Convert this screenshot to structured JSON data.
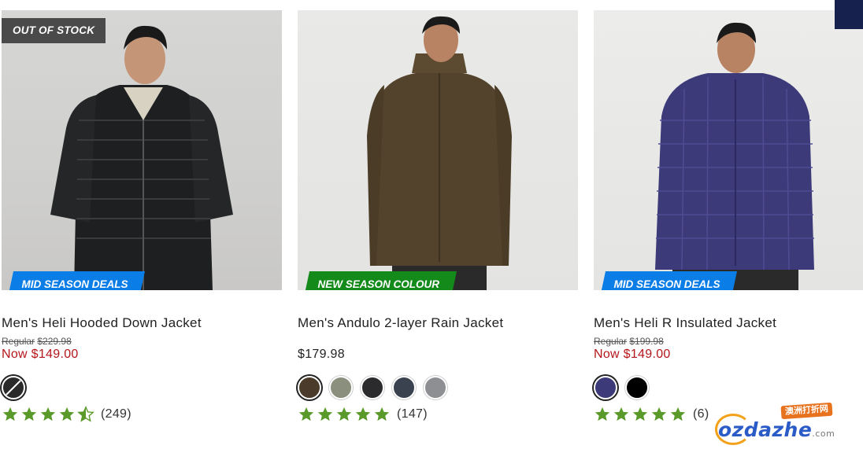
{
  "products": [
    {
      "name": "Men's Heli Hooded Down Jacket",
      "stock_badge": "OUT OF STOCK",
      "promo": "MID SEASON DEALS",
      "promo_color": "#0a7de6",
      "regular_label": "Regular",
      "regular_price": "$229.98",
      "now_price": "Now $149.00",
      "price": "",
      "swatches": [
        {
          "color": "#2a2a2a",
          "selected": true,
          "unavailable": true
        }
      ],
      "rating": 4.5,
      "review_count": "(249)"
    },
    {
      "name": "Men's Andulo 2-layer Rain Jacket",
      "promo": "NEW SEASON COLOUR",
      "promo_color": "#148a1b",
      "price": "$179.98",
      "swatches": [
        {
          "color": "#4a3b2a",
          "selected": true
        },
        {
          "color": "#8a8f7e",
          "selected": false
        },
        {
          "color": "#2b2b2d",
          "selected": false
        },
        {
          "color": "#3a4250",
          "selected": false
        },
        {
          "color": "#8e8f93",
          "selected": false
        }
      ],
      "rating": 5,
      "review_count": "(147)"
    },
    {
      "name": "Men's Heli R Insulated Jacket",
      "promo": "MID SEASON DEALS",
      "promo_color": "#0a7de6",
      "regular_label": "Regular",
      "regular_price": "$199.98",
      "now_price": "Now $149.00",
      "price": "",
      "swatches": [
        {
          "color": "#3d3a7a",
          "selected": true
        },
        {
          "color": "#000000",
          "selected": false
        }
      ],
      "rating": 5,
      "review_count": "(6)"
    }
  ],
  "watermark": {
    "tag": "澳洲打折网",
    "logo": "ozdazhe",
    "suffix": ".com"
  },
  "colors": {
    "star": "#5a9a2a",
    "sale_price": "#b5161a",
    "corner_tab": "#16214d"
  }
}
